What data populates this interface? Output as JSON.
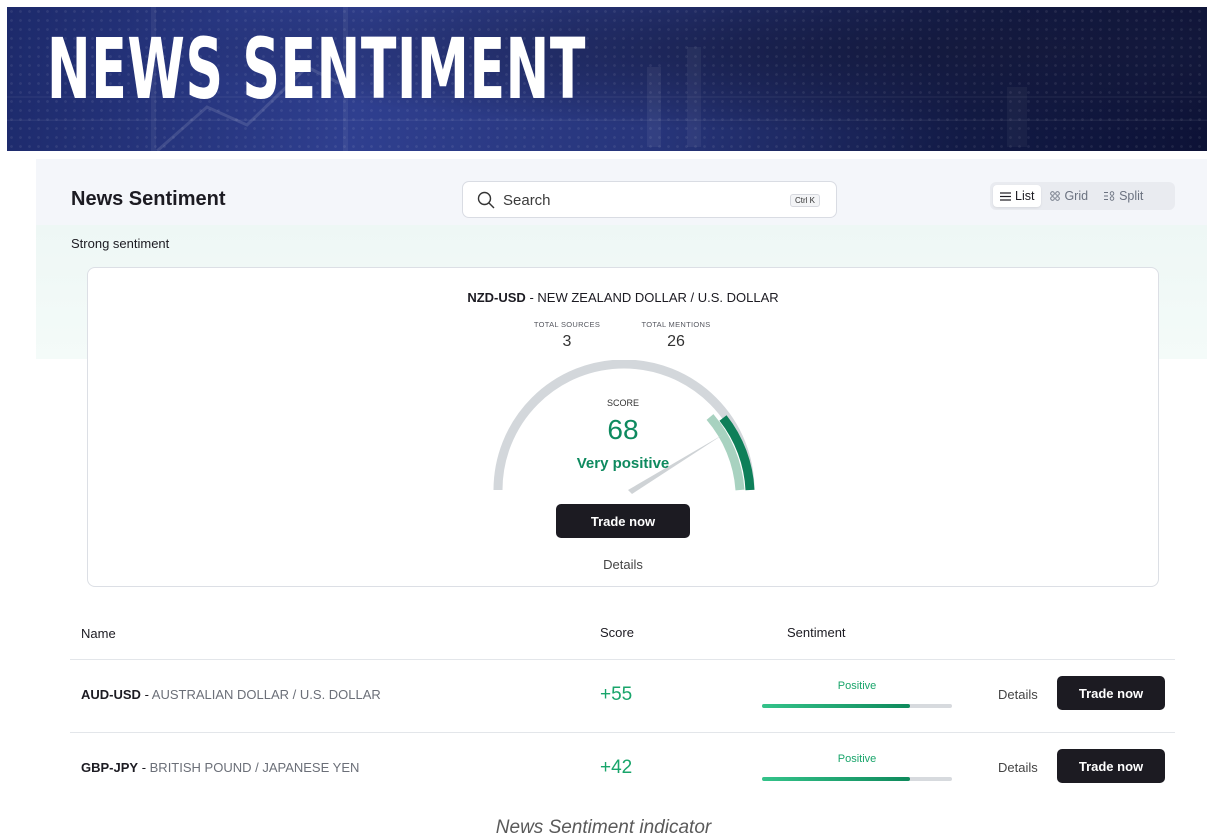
{
  "banner": {
    "title": "NEWS SENTIMENT"
  },
  "header": {
    "title": "News Sentiment",
    "search": {
      "placeholder": "Search",
      "shortcut": "Ctrl K"
    },
    "views": [
      {
        "label": "List",
        "icon": "list-icon",
        "active": true
      },
      {
        "label": "Grid",
        "icon": "grid-icon",
        "active": false
      },
      {
        "label": "Split",
        "icon": "split-icon",
        "active": false
      }
    ]
  },
  "section_label": "Strong sentiment",
  "featured": {
    "symbol": "NZD-USD",
    "name": "NEW ZEALAND DOLLAR / U.S. DOLLAR",
    "total_sources_label": "TOTAL SOURCES",
    "total_sources": "3",
    "total_mentions_label": "TOTAL MENTIONS",
    "total_mentions": "26",
    "score_label": "SCORE",
    "score": "68",
    "score_value": 68,
    "sentiment": "Very positive",
    "trade_label": "Trade now",
    "details_label": "Details"
  },
  "table": {
    "headers": {
      "name": "Name",
      "score": "Score",
      "sentiment": "Sentiment"
    },
    "rows": [
      {
        "symbol": "AUD-USD",
        "name": "AUSTRALIAN DOLLAR / U.S. DOLLAR",
        "score": "+55",
        "sentiment": "Positive",
        "level": 0.78,
        "details": "Details",
        "trade": "Trade now"
      },
      {
        "symbol": "GBP-JPY",
        "name": "BRITISH POUND / JAPANESE YEN",
        "score": "+42",
        "sentiment": "Positive",
        "level": 0.78,
        "details": "Details",
        "trade": "Trade now"
      }
    ]
  },
  "caption": "News Sentiment indicator",
  "colors": {
    "positive": "#19a56b",
    "dark_button": "#1c1b22",
    "gauge_track": "#d3d7db",
    "gauge_active": "#0e7f59"
  }
}
